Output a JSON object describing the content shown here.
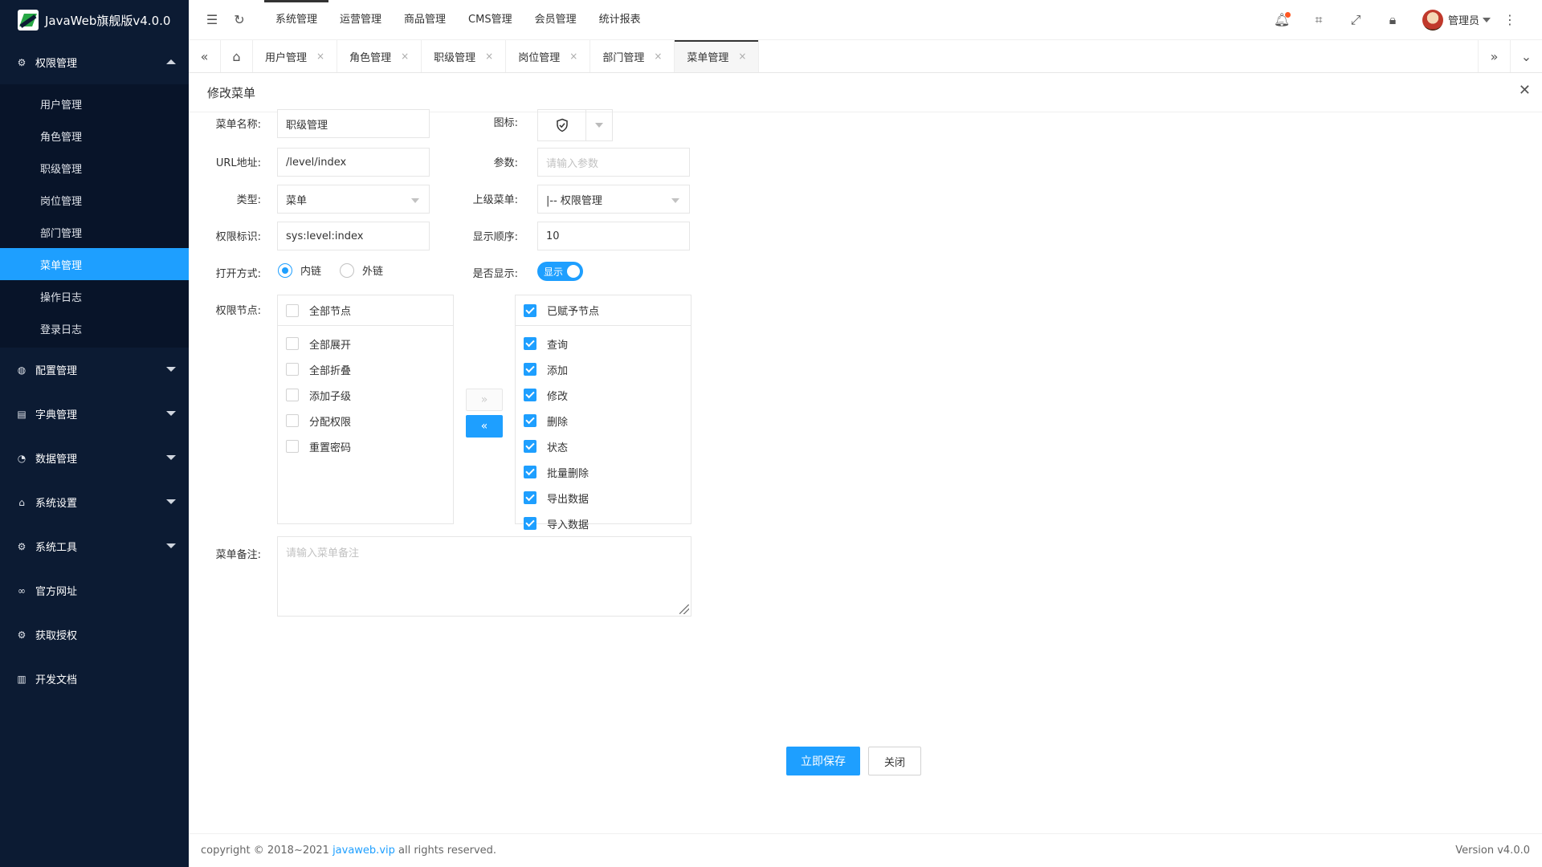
{
  "app": {
    "title": "JavaWeb旗舰版v4.0.0"
  },
  "sidebar": {
    "groups": [
      {
        "label": "权限管理",
        "icon": "gear-icon",
        "expanded": true,
        "items": [
          {
            "label": "用户管理"
          },
          {
            "label": "角色管理"
          },
          {
            "label": "职级管理"
          },
          {
            "label": "岗位管理"
          },
          {
            "label": "部门管理"
          },
          {
            "label": "菜单管理",
            "active": true
          },
          {
            "label": "操作日志"
          },
          {
            "label": "登录日志"
          }
        ]
      },
      {
        "label": "配置管理",
        "icon": "globe-icon"
      },
      {
        "label": "字典管理",
        "icon": "dictionary-icon"
      },
      {
        "label": "数据管理",
        "icon": "palette-icon"
      },
      {
        "label": "系统设置",
        "icon": "home-icon"
      },
      {
        "label": "系统工具",
        "icon": "gear-icon"
      },
      {
        "label": "官方网址",
        "icon": "link-icon"
      },
      {
        "label": "获取授权",
        "icon": "gear-icon"
      },
      {
        "label": "开发文档",
        "icon": "book-icon"
      }
    ]
  },
  "topnav": {
    "items": [
      "系统管理",
      "运营管理",
      "商品管理",
      "CMS管理",
      "会员管理",
      "统计报表"
    ],
    "active_index": 0,
    "user": "管理员"
  },
  "tabs": {
    "items": [
      "用户管理",
      "角色管理",
      "职级管理",
      "岗位管理",
      "部门管理",
      "菜单管理"
    ],
    "active_index": 5,
    "close_glyph": "×"
  },
  "dialog": {
    "title": "修改菜单",
    "labels": {
      "name": "菜单名称:",
      "icon": "图标:",
      "url": "URL地址:",
      "param": "参数:",
      "type": "类型:",
      "parent": "上级菜单:",
      "perm": "权限标识:",
      "sort": "显示顺序:",
      "open": "打开方式:",
      "show": "是否显示:",
      "nodes": "权限节点:",
      "note": "菜单备注:"
    },
    "values": {
      "name": "职级管理",
      "url": "/level/index",
      "param_placeholder": "请输入参数",
      "type": "菜单",
      "parent": "|-- 权限管理",
      "perm": "sys:level:index",
      "sort": "10",
      "open_options": [
        "内链",
        "外链"
      ],
      "open_selected": 0,
      "show_switch": "显示",
      "note_placeholder": "请输入菜单备注"
    },
    "transfer": {
      "left_title": "全部节点",
      "left_items": [
        "全部展开",
        "全部折叠",
        "添加子级",
        "分配权限",
        "重置密码"
      ],
      "right_title": "已赋予节点",
      "right_items": [
        "查询",
        "添加",
        "修改",
        "删除",
        "状态",
        "批量删除",
        "导出数据",
        "导入数据"
      ],
      "to_right": "»",
      "to_left": "«"
    },
    "buttons": {
      "save": "立即保存",
      "close": "关闭"
    }
  },
  "footer": {
    "copyright_prefix": "copyright © 2018~2021 ",
    "link": "javaweb.vip",
    "copyright_suffix": " all rights reserved.",
    "version": "Version v4.0.0"
  },
  "colors": {
    "sidebar_bg": "#0c1b33",
    "accent": "#1e9fff"
  }
}
